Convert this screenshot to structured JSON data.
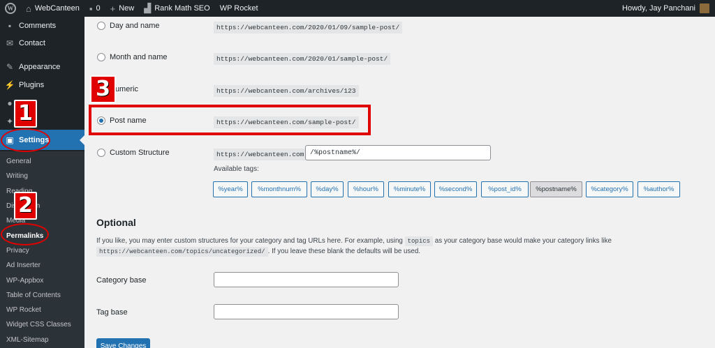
{
  "admin_bar": {
    "site_name": "WebCanteen",
    "comments_count": "0",
    "new_label": "New",
    "rank_math": "Rank Math SEO",
    "wp_rocket": "WP Rocket",
    "greeting": "Howdy, Jay Panchani",
    "wp_logo_glyph": "W"
  },
  "sidebar": {
    "items": [
      {
        "label": "Comments",
        "icon": "comment-icon"
      },
      {
        "label": "Contact",
        "icon": "mail-icon"
      },
      {
        "label": "Appearance",
        "icon": "brush-icon"
      },
      {
        "label": "Plugins",
        "icon": "plugin-icon"
      },
      {
        "label": "Settings",
        "icon": "settings-icon"
      }
    ],
    "submenu": [
      "General",
      "Writing",
      "Reading",
      "Discussion",
      "Media",
      "Permalinks",
      "Privacy",
      "Ad Inserter",
      "WP-Appbox",
      "Table of Contents",
      "WP Rocket",
      "Widget CSS Classes",
      "XML-Sitemap"
    ],
    "active_sub": "Permalinks"
  },
  "permalinks": {
    "options": [
      {
        "label": "Day and name",
        "example": "https://webcanteen.com/2020/01/09/sample-post/",
        "checked": false
      },
      {
        "label": "Month and name",
        "example": "https://webcanteen.com/2020/01/sample-post/",
        "checked": false
      },
      {
        "label": "Numeric",
        "example": "https://webcanteen.com/archives/123",
        "checked": false
      },
      {
        "label": "Post name",
        "example": "https://webcanteen.com/sample-post/",
        "checked": true
      },
      {
        "label": "Custom Structure",
        "example": "https://webcanteen.com",
        "checked": false
      }
    ],
    "custom_value": "/%postname%/",
    "available_tags_label": "Available tags:",
    "tags": [
      "%year%",
      "%monthnum%",
      "%day%",
      "%hour%",
      "%minute%",
      "%second%",
      "%post_id%",
      "%postname%",
      "%category%",
      "%author%"
    ],
    "active_tag": "%postname%"
  },
  "optional": {
    "title": "Optional",
    "desc_before": "If you like, you may enter custom structures for your category and tag URLs here. For example, using",
    "desc_code": "topics",
    "desc_mid": "as your category base would make your category links like",
    "desc_code2": "https://webcanteen.com/topics/uncategorized/",
    "desc_after": ". If you leave these blank the defaults will be used.",
    "category_base_label": "Category base",
    "tag_base_label": "Tag base",
    "category_base_value": "",
    "tag_base_value": ""
  },
  "save_label": "Save Changes",
  "annotations": [
    "1",
    "2",
    "3"
  ],
  "colors": {
    "accent": "#2271b1",
    "annotation": "#e00000",
    "admin_dark": "#1d2327"
  }
}
